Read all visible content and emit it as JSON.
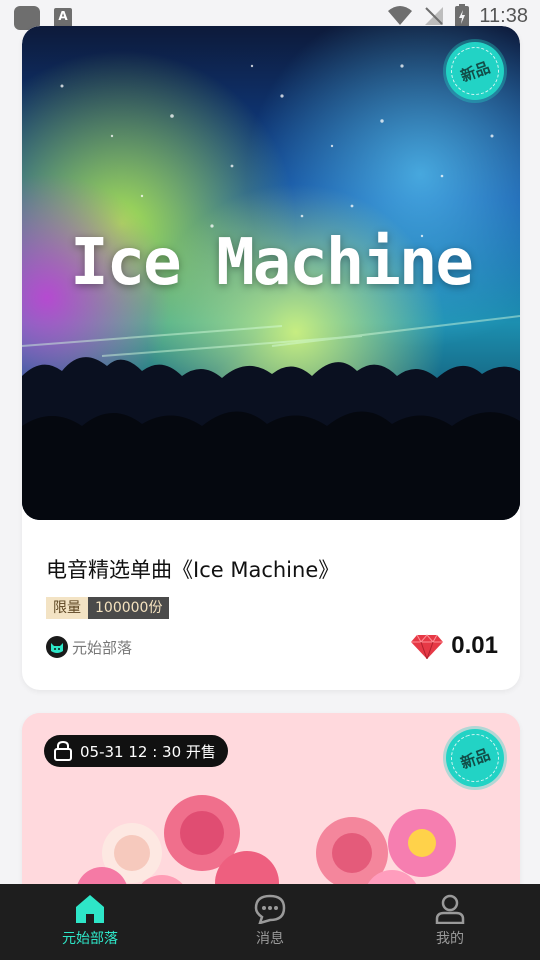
{
  "status_bar": {
    "time": "11:38",
    "a_label": "A"
  },
  "card1": {
    "cover_text": "Ice Machine",
    "badge": "新品",
    "title": "电音精选单曲《Ice Machine》",
    "tag_limit": "限量",
    "tag_count": "100000份",
    "creator": "元始部落",
    "price": "0.01",
    "price_icon": "diamond-icon"
  },
  "card2": {
    "sale_time": "05-31 12 : 30 开售",
    "badge": "新品",
    "lock_icon": "lock-icon"
  },
  "tabs": [
    {
      "label": "元始部落",
      "icon": "home-icon",
      "active": true
    },
    {
      "label": "消息",
      "icon": "chat-icon",
      "active": false
    },
    {
      "label": "我的",
      "icon": "user-icon",
      "active": false
    }
  ],
  "colors": {
    "accent": "#2ee6c8",
    "badge": "#22d3c5",
    "card2_bg": "#ffd9dd"
  }
}
